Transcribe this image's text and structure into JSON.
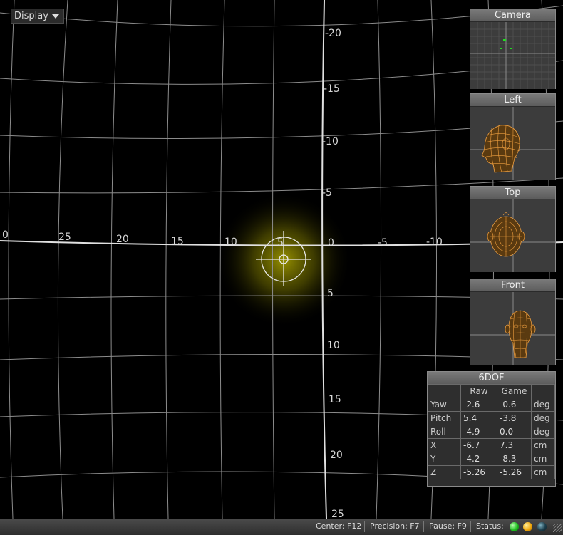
{
  "toolbar": {
    "display_label": "Display"
  },
  "axis": {
    "horizontal_labels": [
      "0",
      "25",
      "20",
      "15",
      "10",
      "5",
      "0",
      "-5",
      "-10"
    ],
    "vertical_labels": [
      "-20",
      "-15",
      "-10",
      "-5",
      "5",
      "10",
      "15",
      "20",
      "25"
    ]
  },
  "panels": {
    "camera": {
      "title": "Camera"
    },
    "left": {
      "title": "Left"
    },
    "top": {
      "title": "Top"
    },
    "front": {
      "title": "Front"
    }
  },
  "dof": {
    "title": "6DOF",
    "headers": [
      "",
      "Raw",
      "Game",
      ""
    ],
    "rows": [
      {
        "label": "Yaw",
        "raw": "-2.6",
        "game": "-0.6",
        "unit": "deg"
      },
      {
        "label": "Pitch",
        "raw": "5.4",
        "game": "-3.8",
        "unit": "deg"
      },
      {
        "label": "Roll",
        "raw": "-4.9",
        "game": "0.0",
        "unit": "deg"
      },
      {
        "label": "X",
        "raw": "-6.7",
        "game": "7.3",
        "unit": "cm"
      },
      {
        "label": "Y",
        "raw": "-4.2",
        "game": "-8.3",
        "unit": "cm"
      },
      {
        "label": "Z",
        "raw": "-5.26",
        "game": "-5.26",
        "unit": "cm"
      }
    ]
  },
  "statusbar": {
    "center": "Center: F12",
    "precision": "Precision: F7",
    "pause": "Pause: F9",
    "status": "Status:"
  },
  "colors": {
    "grid": "#8c8c8c",
    "axis": "#e0e0e0",
    "glow": "#c8c000",
    "head_wire": "#f0a040",
    "led_green": "#1fbf1f",
    "led_orange": "#f2a80a"
  }
}
